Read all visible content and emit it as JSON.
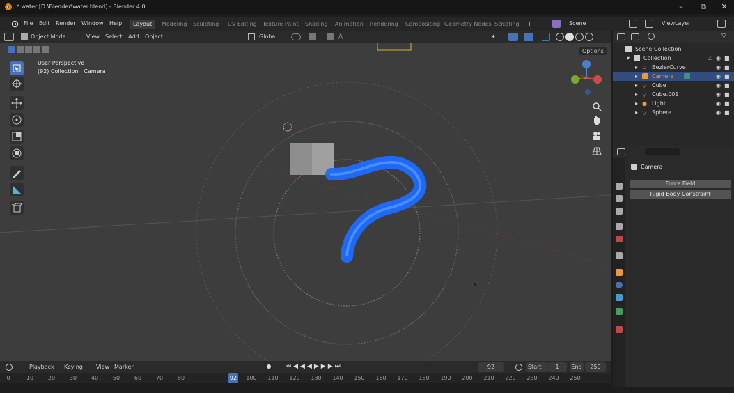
{
  "window": {
    "title": "* water [D:\\Blender\\water.blend] - Blender 4.0"
  },
  "menubar": {
    "file": "File",
    "edit": "Edit",
    "render": "Render",
    "window": "Window",
    "help": "Help",
    "tabs": [
      "Layout",
      "Modeling",
      "Sculpting",
      "UV Editing",
      "Texture Paint",
      "Shading",
      "Animation",
      "Rendering",
      "Compositing",
      "Geometry Nodes",
      "Scripting"
    ],
    "add_tab": "+",
    "scene": "Scene",
    "viewlayer": "ViewLayer"
  },
  "viewport_header": {
    "mode": "Object Mode",
    "view": "View",
    "select": "Select",
    "add": "Add",
    "object": "Object",
    "transform": "Global",
    "options": "Options"
  },
  "viewport": {
    "perspective": "User Perspective",
    "collection_info": "(92) Collection | Camera",
    "accent": "#4772b3",
    "curve_color": "#1f6bff"
  },
  "timeline": {
    "playback": "Playback",
    "keying": "Keying",
    "view": "View",
    "marker": "Marker",
    "current_frame": "92",
    "start_label": "Start",
    "start": "1",
    "end_label": "End",
    "end": "250",
    "ticks": [
      "0",
      "10",
      "20",
      "30",
      "40",
      "50",
      "60",
      "70",
      "80",
      "92",
      "100",
      "110",
      "120",
      "130",
      "140",
      "150",
      "160",
      "170",
      "180",
      "190",
      "200",
      "210",
      "220",
      "230",
      "240",
      "250"
    ]
  },
  "outliner": {
    "items": [
      {
        "label": "Scene Collection",
        "icon": "scene-collection-icon"
      },
      {
        "label": "Collection",
        "icon": "collection-icon"
      },
      {
        "label": "BezierCurve",
        "icon": "curve-icon"
      },
      {
        "label": "Camera",
        "icon": "camera-icon",
        "selected": true
      },
      {
        "label": "Cube",
        "icon": "mesh-icon"
      },
      {
        "label": "Cube.001",
        "icon": "mesh-icon"
      },
      {
        "label": "Light",
        "icon": "light-icon"
      },
      {
        "label": "Sphere",
        "icon": "mesh-icon"
      }
    ]
  },
  "properties": {
    "object_name": "Camera",
    "buttons": [
      "Force Field",
      "Rigid Body Constraint"
    ]
  }
}
